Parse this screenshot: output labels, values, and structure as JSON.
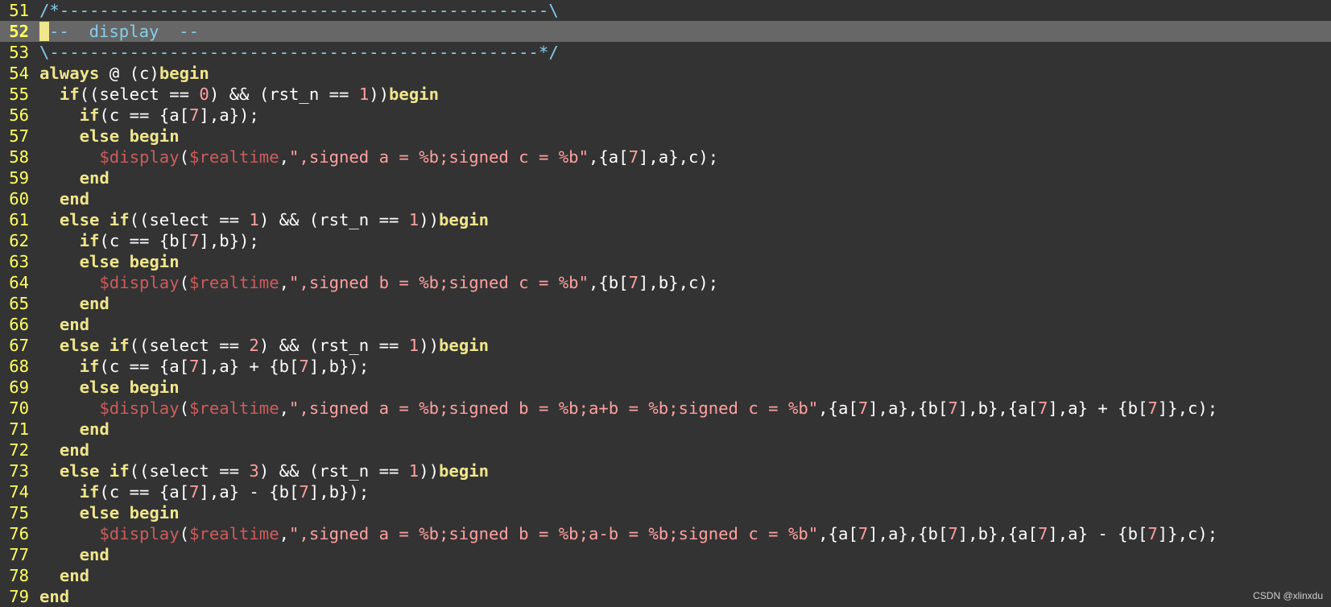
{
  "editor": {
    "current_line": 52,
    "colors": {
      "background": "#333333",
      "cursorline": "#676767",
      "line_number": "#ffff60",
      "keyword": "#f0e68c",
      "number": "#ffa0a0",
      "string": "#ffa0a0",
      "system_task": "#cd5c5c",
      "comment": "#87ceeb",
      "plain": "#ffffff"
    },
    "lines": [
      {
        "n": "51",
        "tokens": [
          {
            "t": "comment",
            "v": "/*-------------------------------------------------\\"
          }
        ]
      },
      {
        "n": "52",
        "tokens": [
          {
            "t": "cursor",
            "v": ""
          },
          {
            "t": "comment",
            "v": "--  display  --"
          }
        ]
      },
      {
        "n": "53",
        "tokens": [
          {
            "t": "comment",
            "v": "\\-------------------------------------------------*/"
          }
        ]
      },
      {
        "n": "54",
        "tokens": [
          {
            "t": "kw",
            "v": "always"
          },
          {
            "t": "plain",
            "v": " @ (c)"
          },
          {
            "t": "kw",
            "v": "begin"
          }
        ]
      },
      {
        "n": "55",
        "tokens": [
          {
            "t": "plain",
            "v": "  "
          },
          {
            "t": "kw",
            "v": "if"
          },
          {
            "t": "plain",
            "v": "((select == "
          },
          {
            "t": "num",
            "v": "0"
          },
          {
            "t": "plain",
            "v": ") && (rst_n == "
          },
          {
            "t": "num",
            "v": "1"
          },
          {
            "t": "plain",
            "v": "))"
          },
          {
            "t": "kw",
            "v": "begin"
          }
        ]
      },
      {
        "n": "56",
        "tokens": [
          {
            "t": "plain",
            "v": "    "
          },
          {
            "t": "kw",
            "v": "if"
          },
          {
            "t": "plain",
            "v": "(c == {a["
          },
          {
            "t": "num",
            "v": "7"
          },
          {
            "t": "plain",
            "v": "],a});"
          }
        ]
      },
      {
        "n": "57",
        "tokens": [
          {
            "t": "plain",
            "v": "    "
          },
          {
            "t": "kw",
            "v": "else begin"
          }
        ]
      },
      {
        "n": "58",
        "tokens": [
          {
            "t": "plain",
            "v": "      "
          },
          {
            "t": "sys",
            "v": "$display"
          },
          {
            "t": "plain",
            "v": "("
          },
          {
            "t": "sys",
            "v": "$realtime"
          },
          {
            "t": "plain",
            "v": ","
          },
          {
            "t": "str",
            "v": "\",signed a = %b;signed c = %b\""
          },
          {
            "t": "plain",
            "v": ",{a["
          },
          {
            "t": "num",
            "v": "7"
          },
          {
            "t": "plain",
            "v": "],a},c);"
          }
        ]
      },
      {
        "n": "59",
        "tokens": [
          {
            "t": "plain",
            "v": "    "
          },
          {
            "t": "kw",
            "v": "end"
          }
        ]
      },
      {
        "n": "60",
        "tokens": [
          {
            "t": "plain",
            "v": "  "
          },
          {
            "t": "kw",
            "v": "end"
          }
        ]
      },
      {
        "n": "61",
        "tokens": [
          {
            "t": "plain",
            "v": "  "
          },
          {
            "t": "kw",
            "v": "else if"
          },
          {
            "t": "plain",
            "v": "((select == "
          },
          {
            "t": "num",
            "v": "1"
          },
          {
            "t": "plain",
            "v": ") && (rst_n == "
          },
          {
            "t": "num",
            "v": "1"
          },
          {
            "t": "plain",
            "v": "))"
          },
          {
            "t": "kw",
            "v": "begin"
          }
        ]
      },
      {
        "n": "62",
        "tokens": [
          {
            "t": "plain",
            "v": "    "
          },
          {
            "t": "kw",
            "v": "if"
          },
          {
            "t": "plain",
            "v": "(c == {b["
          },
          {
            "t": "num",
            "v": "7"
          },
          {
            "t": "plain",
            "v": "],b});"
          }
        ]
      },
      {
        "n": "63",
        "tokens": [
          {
            "t": "plain",
            "v": "    "
          },
          {
            "t": "kw",
            "v": "else begin"
          }
        ]
      },
      {
        "n": "64",
        "tokens": [
          {
            "t": "plain",
            "v": "      "
          },
          {
            "t": "sys",
            "v": "$display"
          },
          {
            "t": "plain",
            "v": "("
          },
          {
            "t": "sys",
            "v": "$realtime"
          },
          {
            "t": "plain",
            "v": ","
          },
          {
            "t": "str",
            "v": "\",signed b = %b;signed c = %b\""
          },
          {
            "t": "plain",
            "v": ",{b["
          },
          {
            "t": "num",
            "v": "7"
          },
          {
            "t": "plain",
            "v": "],b},c);"
          }
        ]
      },
      {
        "n": "65",
        "tokens": [
          {
            "t": "plain",
            "v": "    "
          },
          {
            "t": "kw",
            "v": "end"
          }
        ]
      },
      {
        "n": "66",
        "tokens": [
          {
            "t": "plain",
            "v": "  "
          },
          {
            "t": "kw",
            "v": "end"
          }
        ]
      },
      {
        "n": "67",
        "tokens": [
          {
            "t": "plain",
            "v": "  "
          },
          {
            "t": "kw",
            "v": "else if"
          },
          {
            "t": "plain",
            "v": "((select == "
          },
          {
            "t": "num",
            "v": "2"
          },
          {
            "t": "plain",
            "v": ") && (rst_n == "
          },
          {
            "t": "num",
            "v": "1"
          },
          {
            "t": "plain",
            "v": "))"
          },
          {
            "t": "kw",
            "v": "begin"
          }
        ]
      },
      {
        "n": "68",
        "tokens": [
          {
            "t": "plain",
            "v": "    "
          },
          {
            "t": "kw",
            "v": "if"
          },
          {
            "t": "plain",
            "v": "(c == {a["
          },
          {
            "t": "num",
            "v": "7"
          },
          {
            "t": "plain",
            "v": "],a} + {b["
          },
          {
            "t": "num",
            "v": "7"
          },
          {
            "t": "plain",
            "v": "],b});"
          }
        ]
      },
      {
        "n": "69",
        "tokens": [
          {
            "t": "plain",
            "v": "    "
          },
          {
            "t": "kw",
            "v": "else begin"
          }
        ]
      },
      {
        "n": "70",
        "tokens": [
          {
            "t": "plain",
            "v": "      "
          },
          {
            "t": "sys",
            "v": "$display"
          },
          {
            "t": "plain",
            "v": "("
          },
          {
            "t": "sys",
            "v": "$realtime"
          },
          {
            "t": "plain",
            "v": ","
          },
          {
            "t": "str",
            "v": "\",signed a = %b;signed b = %b;a+b = %b;signed c = %b\""
          },
          {
            "t": "plain",
            "v": ",{a["
          },
          {
            "t": "num",
            "v": "7"
          },
          {
            "t": "plain",
            "v": "],a},{b["
          },
          {
            "t": "num",
            "v": "7"
          },
          {
            "t": "plain",
            "v": "],b},{a["
          },
          {
            "t": "num",
            "v": "7"
          },
          {
            "t": "plain",
            "v": "],a} + {b["
          },
          {
            "t": "num",
            "v": "7"
          },
          {
            "t": "plain",
            "v": "]},c);"
          }
        ]
      },
      {
        "n": "71",
        "tokens": [
          {
            "t": "plain",
            "v": "    "
          },
          {
            "t": "kw",
            "v": "end"
          }
        ]
      },
      {
        "n": "72",
        "tokens": [
          {
            "t": "plain",
            "v": "  "
          },
          {
            "t": "kw",
            "v": "end"
          }
        ]
      },
      {
        "n": "73",
        "tokens": [
          {
            "t": "plain",
            "v": "  "
          },
          {
            "t": "kw",
            "v": "else if"
          },
          {
            "t": "plain",
            "v": "((select == "
          },
          {
            "t": "num",
            "v": "3"
          },
          {
            "t": "plain",
            "v": ") && (rst_n == "
          },
          {
            "t": "num",
            "v": "1"
          },
          {
            "t": "plain",
            "v": "))"
          },
          {
            "t": "kw",
            "v": "begin"
          }
        ]
      },
      {
        "n": "74",
        "tokens": [
          {
            "t": "plain",
            "v": "    "
          },
          {
            "t": "kw",
            "v": "if"
          },
          {
            "t": "plain",
            "v": "(c == {a["
          },
          {
            "t": "num",
            "v": "7"
          },
          {
            "t": "plain",
            "v": "],a} - {b["
          },
          {
            "t": "num",
            "v": "7"
          },
          {
            "t": "plain",
            "v": "],b});"
          }
        ]
      },
      {
        "n": "75",
        "tokens": [
          {
            "t": "plain",
            "v": "    "
          },
          {
            "t": "kw",
            "v": "else begin"
          }
        ]
      },
      {
        "n": "76",
        "tokens": [
          {
            "t": "plain",
            "v": "      "
          },
          {
            "t": "sys",
            "v": "$display"
          },
          {
            "t": "plain",
            "v": "("
          },
          {
            "t": "sys",
            "v": "$realtime"
          },
          {
            "t": "plain",
            "v": ","
          },
          {
            "t": "str",
            "v": "\",signed a = %b;signed b = %b;a-b = %b;signed c = %b\""
          },
          {
            "t": "plain",
            "v": ",{a["
          },
          {
            "t": "num",
            "v": "7"
          },
          {
            "t": "plain",
            "v": "],a},{b["
          },
          {
            "t": "num",
            "v": "7"
          },
          {
            "t": "plain",
            "v": "],b},{a["
          },
          {
            "t": "num",
            "v": "7"
          },
          {
            "t": "plain",
            "v": "],a} - {b["
          },
          {
            "t": "num",
            "v": "7"
          },
          {
            "t": "plain",
            "v": "]},c);"
          }
        ]
      },
      {
        "n": "77",
        "tokens": [
          {
            "t": "plain",
            "v": "    "
          },
          {
            "t": "kw",
            "v": "end"
          }
        ]
      },
      {
        "n": "78",
        "tokens": [
          {
            "t": "plain",
            "v": "  "
          },
          {
            "t": "kw",
            "v": "end"
          }
        ]
      },
      {
        "n": "79",
        "tokens": [
          {
            "t": "kw",
            "v": "end"
          }
        ]
      }
    ]
  },
  "watermark": "CSDN @xlinxdu"
}
